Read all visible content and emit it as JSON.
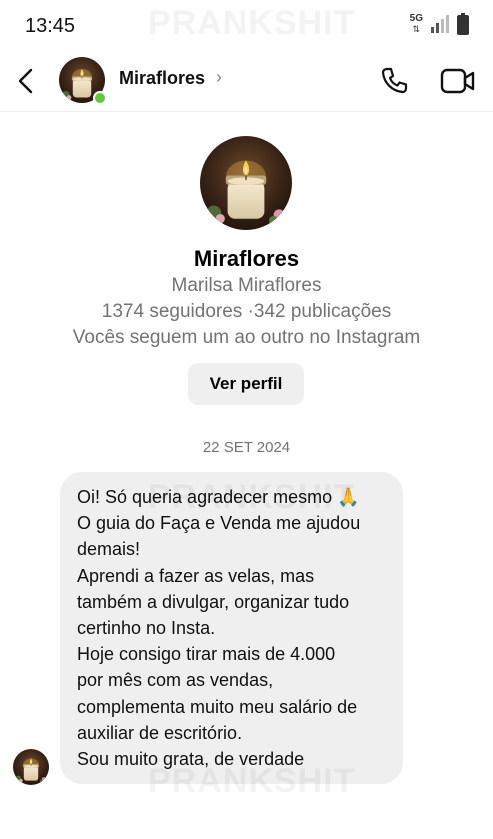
{
  "status_bar": {
    "time": "13:45",
    "network": "5G",
    "watermark": "PRANKSHIT"
  },
  "header": {
    "name": "Miraflores",
    "chevron": "›",
    "icons": [
      "back-arrow-icon",
      "phone-icon",
      "video-icon"
    ],
    "online": true
  },
  "profile": {
    "name": "Miraflores",
    "full_name": "Marilsa Miraflores",
    "stats": "1374 seguidores ·342 publicações",
    "mutual": "Vocês seguem um ao outro no Instagram",
    "view_profile_label": "Ver perfil"
  },
  "chat": {
    "date": "22 SET 2024",
    "message_lines": [
      "Oi! Só queria agradecer mesmo 🙏",
      "O guia do Faça e Venda me ajudou",
      "demais!",
      "Aprendi a fazer as velas, mas",
      "também a divulgar, organizar tudo",
      "certinho no Insta.",
      "Hoje consigo tirar mais de 4.000",
      "por mês com as vendas,",
      "complementa muito meu salário de",
      "auxiliar de escritório.",
      "Sou muito grata, de verdade"
    ]
  },
  "colors": {
    "online": "#5ac93a",
    "bubble": "#efefef",
    "secondary_text": "#737373",
    "button_bg": "#efefef"
  }
}
